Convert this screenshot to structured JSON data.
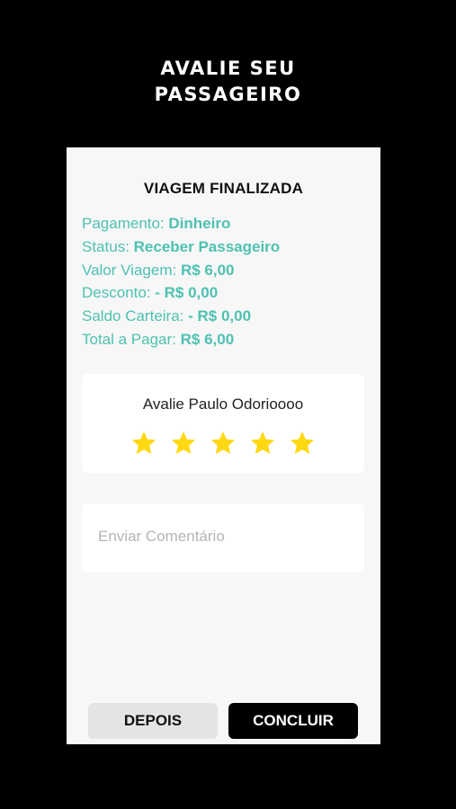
{
  "header": {
    "line1": "AVALIE SEU",
    "line2": "PASSAGEIRO"
  },
  "card": {
    "title": "VIAGEM FINALIZADA",
    "info": [
      {
        "label": "Pagamento: ",
        "value": "Dinheiro"
      },
      {
        "label": "Status: ",
        "value": "Receber Passageiro"
      },
      {
        "label": "Valor Viagem:  ",
        "value": "R$ 6,00"
      },
      {
        "label": "Desconto:  ",
        "value": "-  R$ 0,00"
      },
      {
        "label": "Saldo Carteira:  ",
        "value": "-  R$ 0,00"
      },
      {
        "label": "Total a Pagar:  ",
        "value": "R$ 6,00"
      }
    ],
    "rating": {
      "title": "Avalie Paulo Odorioooo",
      "stars_filled": 5,
      "stars_total": 5
    },
    "comment": {
      "placeholder": "Enviar Comentário",
      "value": ""
    },
    "buttons": {
      "later_label": "DEPOIS",
      "done_label": "CONCLUIR"
    }
  },
  "colors": {
    "background": "#000000",
    "card": "#f7f7f7",
    "accent": "#4ec1b2",
    "star": "#ffd814"
  },
  "icons": {
    "star": "star-icon"
  }
}
